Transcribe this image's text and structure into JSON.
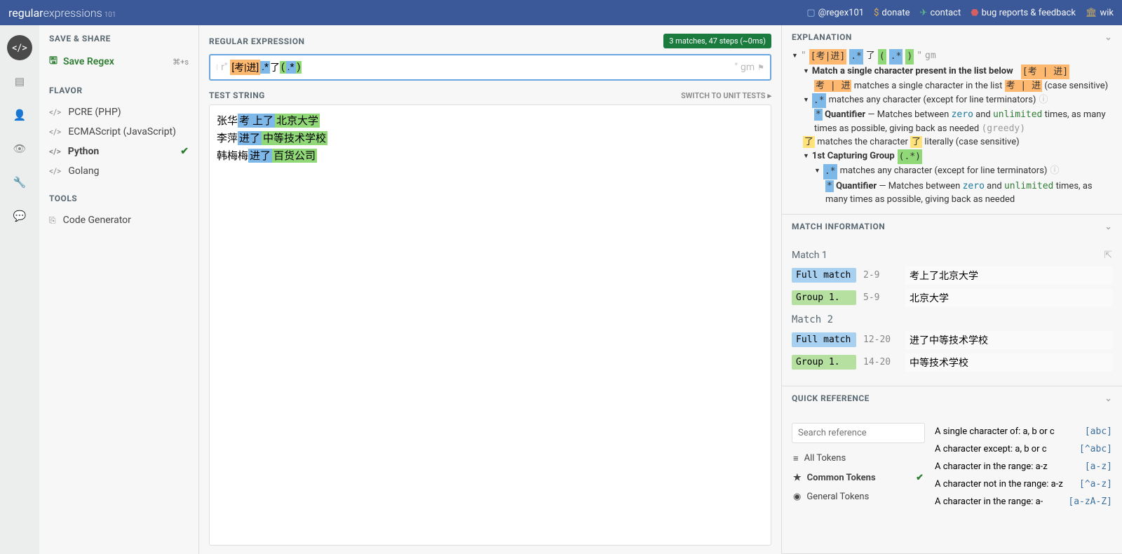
{
  "header": {
    "logo_bold": "regular",
    "logo_thin": "expressions",
    "logo_sub": "101",
    "links": {
      "twitter": "@regex101",
      "donate": "donate",
      "contact": "contact",
      "bugs": "bug reports & feedback",
      "wiki": "wik"
    }
  },
  "sidebar": {
    "save_share": "SAVE & SHARE",
    "save_regex": "Save Regex",
    "save_kbd": "⌘+s",
    "flavor": "FLAVOR",
    "flavors": [
      {
        "label": "PCRE (PHP)"
      },
      {
        "label": "ECMAScript (JavaScript)"
      },
      {
        "label": "Python",
        "active": true
      },
      {
        "label": "Golang"
      }
    ],
    "tools": "TOOLS",
    "code_gen": "Code Generator"
  },
  "editor": {
    "regex_title": "REGULAR EXPRESSION",
    "stats": "3 matches, 47 steps (~0ms)",
    "delim_left": "r\"",
    "delim_right": "\"",
    "flags": "gm",
    "regex_parts": {
      "p1": "[考|进]",
      "p2": ".*",
      "p3": "了",
      "p4": "(",
      "p5": ".*",
      "p6": ")"
    },
    "test_title": "TEST STRING",
    "switch_link": "SWITCH TO UNIT TESTS",
    "test_lines": [
      {
        "pre": "张华",
        "m1": "考",
        "m2": "上了",
        "m3": "北京大学"
      },
      {
        "pre": "李萍",
        "m1": "进了",
        "m2": "",
        "m3": "中等技术学校"
      },
      {
        "pre": "韩梅梅",
        "m1": "进了",
        "m2": "",
        "m3": "百货公司"
      }
    ]
  },
  "explanation": {
    "title": "EXPLANATION",
    "line0_q1": "\" ",
    "line0_q2": " \"",
    "line0_flags": "gm",
    "line1_bold": "Match a single character present in the list below",
    "line1_tok": "[考 | 进]",
    "line2_tok": "考 | 进",
    "line2_text": " matches a single character in the list ",
    "line2_tok2": "考 | 进",
    "line2_tail": " (case sensitive)",
    "line3_tok": ".*",
    "line3_text": " matches any character (except for line terminators) ",
    "line4_star": "*",
    "line4_bold": "Quantifier",
    "line4_text": " — Matches between ",
    "line4_zero": "zero",
    "line4_and": " and ",
    "line4_unl": "unlimited",
    "line4_tail": " times, as many times as possible, giving back as needed ",
    "line4_greedy": "(greedy)",
    "line5_tok": "了",
    "line5_text": " matches the character ",
    "line5_tok2": "了",
    "line5_tail": " literally (case sensitive)",
    "line6_bold": "1st Capturing Group ",
    "line6_tok": "(.*)",
    "line7_tok": ".*",
    "line7_text": " matches any character (except for line terminators) ",
    "line8_star": "*",
    "line8_bold": "Quantifier",
    "line8_text": " — Matches between ",
    "line8_zero": "zero",
    "line8_and": " and ",
    "line8_unl": "unlimited",
    "line8_tail": " times, as many times as possible, giving back as needed"
  },
  "matches": {
    "title": "MATCH INFORMATION",
    "m1": "Match 1",
    "m2": "Match 2",
    "full": "Full match",
    "grp": "Group 1.",
    "rows": [
      {
        "range": "2-9",
        "text": "考上了北京大学"
      },
      {
        "range": "5-9",
        "text": "北京大学"
      },
      {
        "range": "12-20",
        "text": "进了中等技术学校"
      },
      {
        "range": "14-20",
        "text": "中等技术学校"
      }
    ]
  },
  "quickref": {
    "title": "QUICK REFERENCE",
    "search_ph": "Search reference",
    "cats": [
      {
        "label": "All Tokens"
      },
      {
        "label": "Common Tokens",
        "active": true
      },
      {
        "label": "General Tokens"
      }
    ],
    "items": [
      {
        "desc": "A single character of: a, b or c",
        "tok": "[abc]"
      },
      {
        "desc": "A character except: a, b or c",
        "tok": "[^abc]"
      },
      {
        "desc": "A character in the range: a-z",
        "tok": "[a-z]"
      },
      {
        "desc": "A character not in the range: a-z",
        "tok": "[^a-z]"
      },
      {
        "desc": "A character in the range: a-",
        "tok": "[a-zA-Z]"
      }
    ]
  }
}
